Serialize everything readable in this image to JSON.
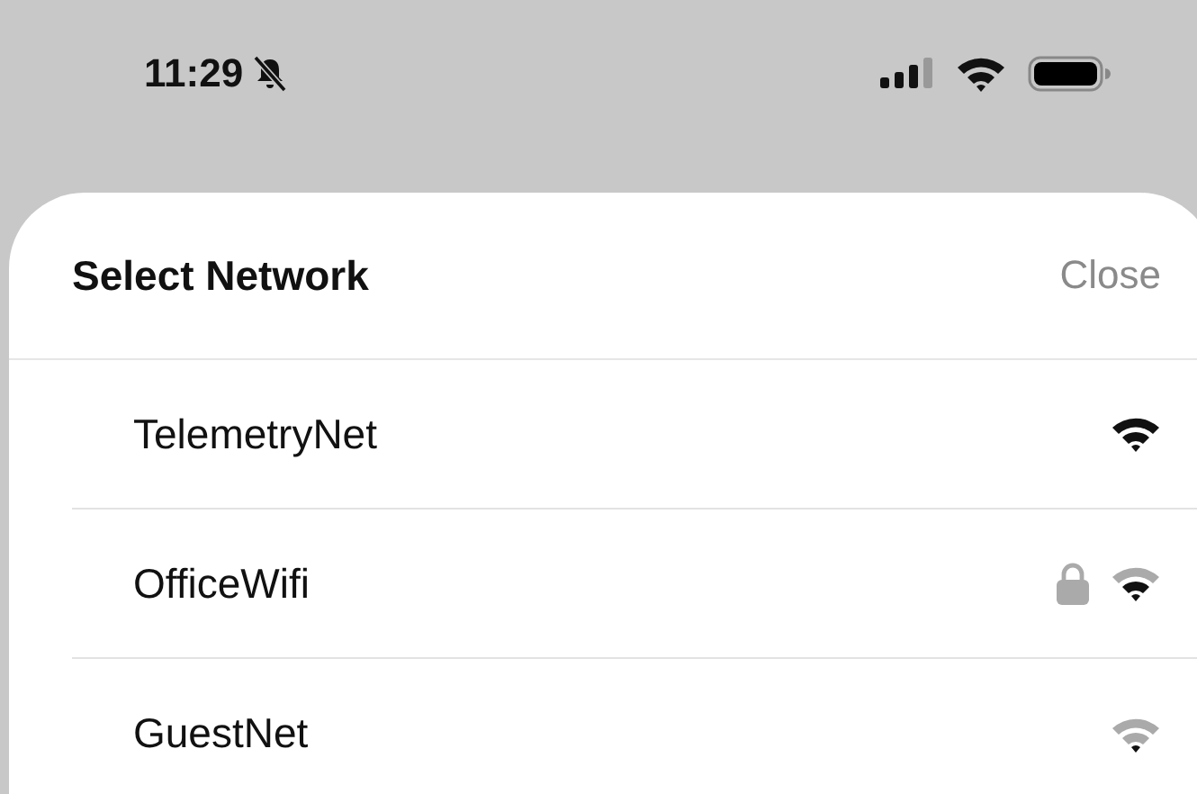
{
  "status_bar": {
    "time": "11:29",
    "silent": true
  },
  "sheet": {
    "title": "Select Network",
    "close": "Close"
  },
  "networks": [
    {
      "name": "TelemetryNet",
      "locked": false,
      "kind": "strong"
    },
    {
      "name": "OfficeWifi",
      "locked": true,
      "kind": "medium"
    },
    {
      "name": "GuestNet",
      "locked": false,
      "kind": "weak"
    }
  ]
}
